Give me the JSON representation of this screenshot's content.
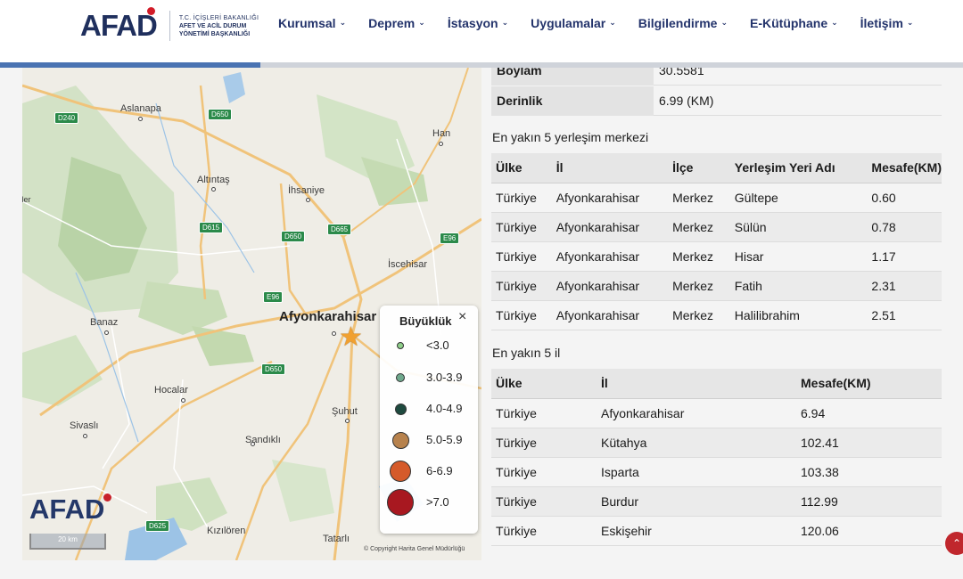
{
  "header": {
    "logo_text": "AFAD",
    "logo_sub": [
      "T.C. İÇİŞLERİ BAKANLIĞI",
      "AFET VE ACİL DURUM",
      "YÖNETİMİ BAŞKANLIĞI"
    ],
    "nav": [
      {
        "label": "Kurumsal"
      },
      {
        "label": "Deprem"
      },
      {
        "label": "İstasyon"
      },
      {
        "label": "Uygulamalar"
      },
      {
        "label": "Bilgilendirme"
      },
      {
        "label": "E-Kütüphane"
      },
      {
        "label": "İletişim"
      }
    ],
    "scroll_progress": 0.27
  },
  "map": {
    "places": {
      "aslanapa": "Aslanapa",
      "altintas": "Altıntaş",
      "ihsaniye": "İhsaniye",
      "han": "Han",
      "iscehisar": "İscehisar",
      "afyonkarahisar": "Afyonkarahisar",
      "banaz": "Banaz",
      "hocalar": "Hocalar",
      "sivasli": "Sivaslı",
      "sandikli": "Sandıklı",
      "suhut": "Şuhut",
      "kiziloren": "Kızılören",
      "tatarli": "Tatarlı",
      "ulubey": "ılder"
    },
    "roads": {
      "d240": "D240",
      "d650a": "D650",
      "d615": "D615",
      "d650b": "D650",
      "d665": "D665",
      "e96a": "E96",
      "e96b": "E96",
      "d650c": "D650",
      "d625": "D625"
    },
    "logo_text": "AFAD",
    "scale_label": "20 km",
    "copyright": "© Copyright Harita Genel Müdürlüğü",
    "legend": {
      "title": "Büyüklük",
      "close": "×",
      "items": [
        {
          "label": "<3.0",
          "color": "#8fcf8a"
        },
        {
          "label": "3.0-3.9",
          "color": "#6fa88c"
        },
        {
          "label": "4.0-4.9",
          "color": "#1e4a3f"
        },
        {
          "label": "5.0-5.9",
          "color": "#b7824d"
        },
        {
          "label": "6-6.9",
          "color": "#d55a2a"
        },
        {
          "label": ">7.0",
          "color": "#a81820"
        }
      ]
    }
  },
  "details": {
    "boylam": {
      "key": "Boylam",
      "value": "30.5581"
    },
    "derinlik": {
      "key": "Derinlik",
      "value": "6.99 (KM)"
    }
  },
  "nearest_settlements": {
    "title": "En yakın 5 yerleşim merkezi",
    "headers": [
      "Ülke",
      "İl",
      "İlçe",
      "Yerleşim Yeri Adı",
      "Mesafe(KM)"
    ],
    "rows": [
      [
        "Türkiye",
        "Afyonkarahisar",
        "Merkez",
        "Gültepe",
        "0.60"
      ],
      [
        "Türkiye",
        "Afyonkarahisar",
        "Merkez",
        "Sülün",
        "0.78"
      ],
      [
        "Türkiye",
        "Afyonkarahisar",
        "Merkez",
        "Hisar",
        "1.17"
      ],
      [
        "Türkiye",
        "Afyonkarahisar",
        "Merkez",
        "Fatih",
        "2.31"
      ],
      [
        "Türkiye",
        "Afyonkarahisar",
        "Merkez",
        "Halilibrahim",
        "2.51"
      ]
    ]
  },
  "nearest_provinces": {
    "title": "En yakın 5 il",
    "headers": [
      "Ülke",
      "İl",
      "Mesafe(KM)"
    ],
    "rows": [
      [
        "Türkiye",
        "Afyonkarahisar",
        "6.94"
      ],
      [
        "Türkiye",
        "Kütahya",
        "102.41"
      ],
      [
        "Türkiye",
        "Isparta",
        "103.38"
      ],
      [
        "Türkiye",
        "Burdur",
        "112.99"
      ],
      [
        "Türkiye",
        "Eskişehir",
        "120.06"
      ]
    ]
  },
  "colors": {
    "brand": "#1f2f5d",
    "nav": "#23336b",
    "accent_red": "#c0272d",
    "epicenter": "#f0a030"
  },
  "icons": {
    "scroll_top": "chevron-up-icon",
    "epicenter": "star-icon"
  }
}
